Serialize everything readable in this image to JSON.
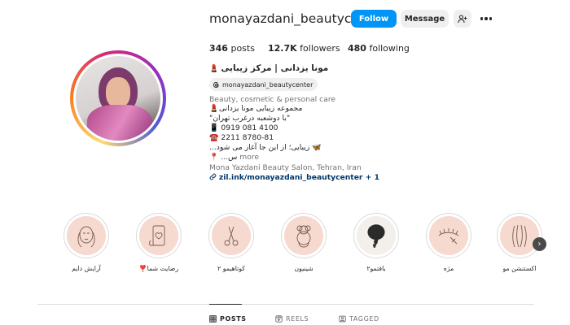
{
  "profile": {
    "username": "monayazdani_beautycenter",
    "follow_label": "Follow",
    "message_label": "Message",
    "avatar_icon": "suggest-user-icon"
  },
  "stats": {
    "posts_count": "346",
    "posts_label": " posts",
    "followers_count": "12.7K",
    "followers_label": " followers",
    "following_count": "480",
    "following_label": " following"
  },
  "bio": {
    "name": "مونا یزدانی | مرکز زیبایی",
    "threads_handle": "monayazdani_beautycenter",
    "category": "Beauty, cosmetic & personal care",
    "line1": "مجموعه زیبایی مونا یزدانی",
    "line2": "\"با دوشعبه درغرب تهران\"",
    "phone1": "0919 081 4100",
    "phone2": "2211 8780-81",
    "line5": "زیبایی؛ از این جا آغاز می شود...",
    "line6": "س...",
    "more": " more",
    "location": "Mona Yazdani Beauty Salon, Tehran, Iran",
    "link": "zil.ink/monayazdani_beautycenter",
    "link_extra": " + 1",
    "emoji_lipstick": "💄",
    "emoji_phone": "📱",
    "emoji_tel": "☎️",
    "emoji_butterfly": "🦋",
    "emoji_pin": "📍"
  },
  "highlights": [
    {
      "label": "آرایش دایم"
    },
    {
      "label": "رضایت شما❣️"
    },
    {
      "label": "کوتاهیمو ۲"
    },
    {
      "label": "شینیون"
    },
    {
      "label": "بافتمو۲"
    },
    {
      "label": "مژه"
    },
    {
      "label": "اکستنشن مو"
    }
  ],
  "tabs": {
    "posts": "POSTS",
    "reels": "REELS",
    "tagged": "TAGGED"
  },
  "colors": {
    "follow_blue": "#0095f6",
    "highlight_bg": "#f6d9cf",
    "link_blue": "#00376b"
  }
}
